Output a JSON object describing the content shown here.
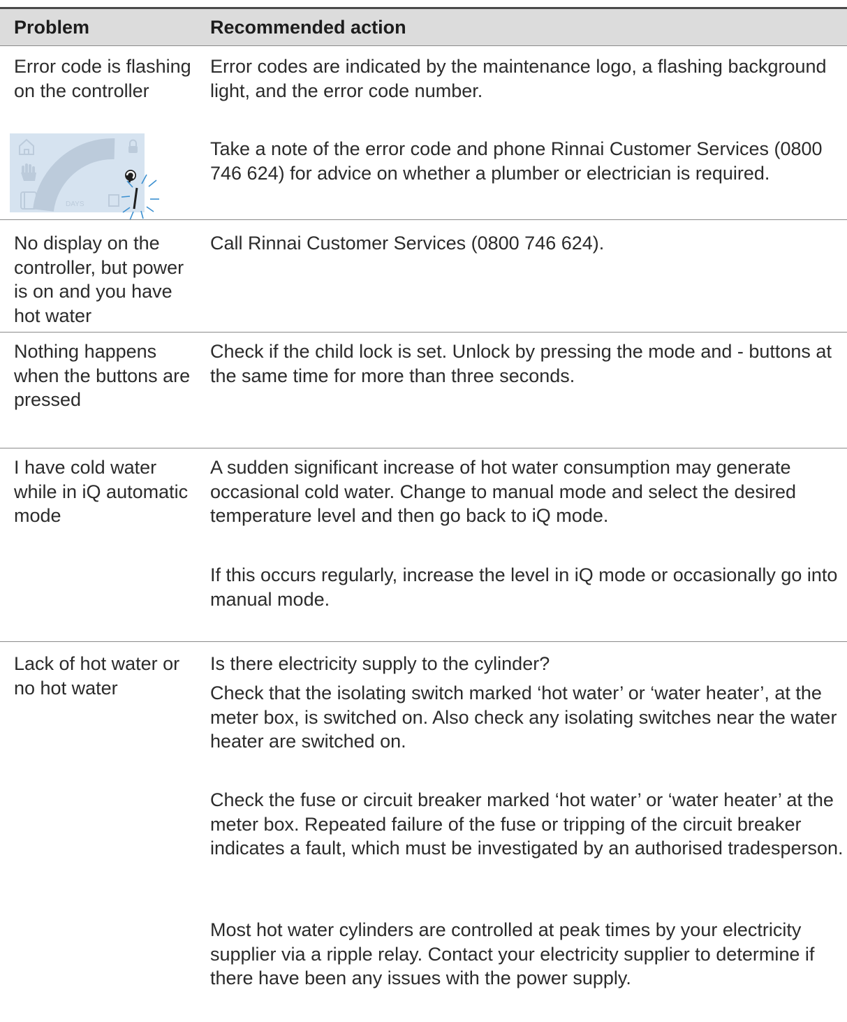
{
  "header": {
    "col_problem": "Problem",
    "col_action": "Recommended action"
  },
  "rows": [
    {
      "problem": "Error code is flashing on the controller",
      "actions": [
        "Error codes are indicated by the maintenance logo, a flashing background light, and the error code number.",
        "Take a note of the error code and phone Rinnai Customer Services (0800 746 624) for advice on whether a plumber or electrician is required."
      ],
      "display": {
        "days_label": "DAYS",
        "error_digit": "1"
      }
    },
    {
      "problem": "No display on the controller, but power is on and you have hot water",
      "actions": [
        "Call Rinnai Customer Services (0800 746 624)."
      ]
    },
    {
      "problem": "Nothing happens when the buttons are pressed",
      "actions": [
        "Check if the child lock is set. Unlock by pressing the mode and - buttons at the same time for more than three seconds."
      ]
    },
    {
      "problem": "I have cold water while in iQ automatic mode",
      "actions": [
        "A sudden significant increase of hot water consumption may generate occasional cold water. Change to manual mode and select the desired temperature level and then go back to iQ mode.",
        "If this occurs regularly, increase the level in iQ mode or occasionally go into manual mode."
      ]
    },
    {
      "problem": "Lack of hot water or no hot water",
      "actions": [
        "Is there electricity supply to the cylinder?",
        "Check that the isolating switch marked ‘hot water’ or ‘water heater’, at the meter box, is switched on. Also check any isolating switches near the water heater are switched on.",
        "Check the fuse or circuit breaker marked ‘hot water’ or ‘water heater’ at the meter box. Repeated failure of the fuse or tripping of the circuit breaker indicates a fault, which must be investigated by an authorised tradesperson.",
        "Most hot water cylinders are controlled at peak times by your electricity supplier via a ripple relay. Contact your electricity supplier to determine if there have been any issues with the power supply."
      ]
    }
  ]
}
